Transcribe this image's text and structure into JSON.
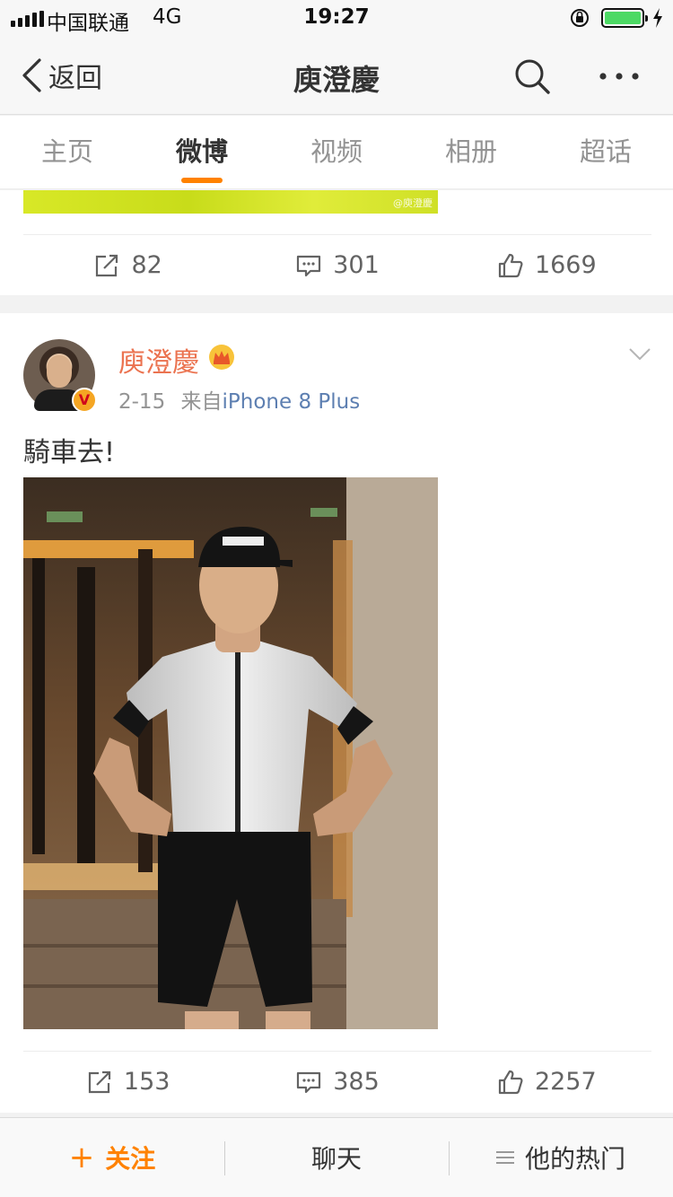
{
  "status_bar": {
    "carrier": "中国联通",
    "network": "4G",
    "time": "19:27"
  },
  "nav": {
    "back_label": "返回",
    "title": "庾澄慶"
  },
  "tabs": [
    {
      "label": "主页",
      "active": false
    },
    {
      "label": "微博",
      "active": true
    },
    {
      "label": "视频",
      "active": false
    },
    {
      "label": "相册",
      "active": false
    },
    {
      "label": "超话",
      "active": false
    }
  ],
  "previous_post": {
    "image_watermark": "@庾澄慶",
    "reposts": "82",
    "comments": "301",
    "likes": "1669"
  },
  "post": {
    "username": "庾澄慶",
    "date": "2-15",
    "source_prefix": "来自",
    "device": "iPhone 8 Plus",
    "text": "騎車去!",
    "reposts": "153",
    "comments": "385",
    "likes": "2257"
  },
  "bottom_bar": {
    "follow": "关注",
    "chat": "聊天",
    "hot": "他的热门"
  },
  "colors": {
    "accent": "#ff8200",
    "username": "#eb7350",
    "link": "#5d7fb1"
  }
}
